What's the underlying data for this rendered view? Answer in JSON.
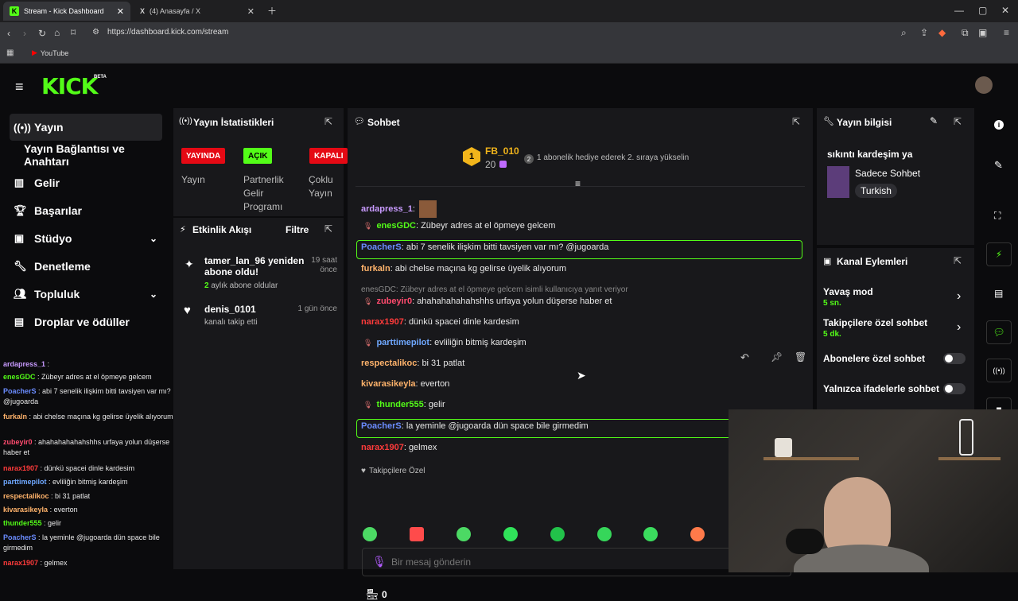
{
  "browser": {
    "tabs": [
      {
        "title": "Stream - Kick Dashboard",
        "active": true
      },
      {
        "title": "(4) Anasayfa / X",
        "active": false
      }
    ],
    "url": "https://dashboard.kick.com/stream",
    "bookmarks": [
      "YouTube"
    ]
  },
  "brand": {
    "logo": "KICK",
    "beta": "BETA",
    "accent": "#53fc18"
  },
  "sidebar": {
    "items": [
      {
        "label": "Yayın",
        "icon": "broadcast-icon",
        "active": true
      },
      {
        "label": "Yayın Bağlantısı ve Anahtarı",
        "icon": "",
        "active": false
      },
      {
        "label": "Gelir",
        "icon": "chart-icon",
        "active": false
      },
      {
        "label": "Başarılar",
        "icon": "trophy-icon",
        "active": false
      },
      {
        "label": "Stüdyo",
        "icon": "studio-icon",
        "active": false,
        "chevron": true
      },
      {
        "label": "Denetleme",
        "icon": "wrench-icon",
        "active": false
      },
      {
        "label": "Topluluk",
        "icon": "users-icon",
        "active": false,
        "chevron": true
      },
      {
        "label": "Droplar ve ödüller",
        "icon": "gift-icon",
        "active": false
      }
    ]
  },
  "side_chat": [
    {
      "user": "ardapress_1",
      "color": "#c99bff",
      "text": " : "
    },
    {
      "user": "enesGDC",
      "color": "#53fc18",
      "text": " : Zübeyr adres at el öpmeye gelcem"
    },
    {
      "user": "PoacherS",
      "color": "#6b8cff",
      "text": " : abi 7 senelik ilişkim bitti tavsiyen var mı? @jugoarda"
    },
    {
      "user": "furkaln",
      "color": "#ffb36b",
      "text": " : abi chelse maçına kg gelirse üyelik alıyorum"
    },
    {
      "user": "zubeyir0",
      "color": "#ff4b6e",
      "text": " : ahahahahahahshhs urfaya yolun düşerse haber et"
    },
    {
      "user": "narax1907",
      "color": "#ff3b3b",
      "text": " : dünkü spacei dinle kardesim"
    },
    {
      "user": "parttimepilot",
      "color": "#6fa8ff",
      "text": " : evliliğin bitmiş kardeşim"
    },
    {
      "user": "respectalikoc",
      "color": "#ffb36b",
      "text": " : bi 31 patlat"
    },
    {
      "user": "kivarasikeyla",
      "color": "#ffb36b",
      "text": " : everton"
    },
    {
      "user": "thunder555",
      "color": "#53fc18",
      "text": " : gelir"
    },
    {
      "user": "PoacherS",
      "color": "#6b8cff",
      "text": " : la yeminle @jugoarda dün space bile girmedim"
    },
    {
      "user": "narax1907",
      "color": "#ff3b3b",
      "text": " : gelmex"
    }
  ],
  "stats": {
    "title": "Yayın İstatistikleri",
    "badges": [
      {
        "text": "YAYINDA",
        "color": "#e50914",
        "text_color": "#ffffff",
        "label": "Yayın"
      },
      {
        "text": "AÇIK",
        "color": "#53fc18",
        "text_color": "#000000",
        "label": "Partnerlik Gelir Programı"
      },
      {
        "text": "KAPALI",
        "color": "#e50914",
        "text_color": "#ffffff",
        "label": "Çoklu Yayın"
      }
    ]
  },
  "activity": {
    "title": "Etkinlik Akışı",
    "filter": "Filtre",
    "items": [
      {
        "icon": "sparkle-icon",
        "title": "tamer_lan_96 yeniden abone oldu!",
        "highlight": "2",
        "detail": " aylık abone oldular",
        "time": "19 saat önce"
      },
      {
        "icon": "heart-icon",
        "title": "denis_0101",
        "highlight": "",
        "detail": "kanalı takip etti",
        "time": "1 gün önce"
      }
    ]
  },
  "chat": {
    "title": "Sohbet",
    "top_gifter": {
      "rank": "1",
      "name": "FB_010",
      "count": "20"
    },
    "gift_prompt": "1 abonelik hediye ederek 2. sıraya yükselin",
    "messages": [
      {
        "user": "ardapress_1",
        "color": "#c99bff",
        "text": ": "
      },
      {
        "user": "enesGDC",
        "color": "#53fc18",
        "text": ": Zübeyr adres at el öpmeye gelcem"
      },
      {
        "user": "PoacherS",
        "color": "#6b8cff",
        "text": ": abi 7 senelik ilişkim bitti tavsiyen var mı? @jugoarda",
        "highlight": true
      },
      {
        "user": "furkaln",
        "color": "#ffb36b",
        "text": ": abi chelse maçına kg gelirse üyelik alıyorum"
      },
      {
        "reply": "enesGDC: Zübeyr adres at el öpmeye gelcem isimli kullanıcıya yanıt veriyor",
        "user": "zubeyir0",
        "color": "#ff4b6e",
        "text": ": ahahahahahahshhs urfaya yolun düşerse haber et"
      },
      {
        "user": "narax1907",
        "color": "#ff3b3b",
        "text": ": dünkü spacei dinle kardesim"
      },
      {
        "user": "parttimepilot",
        "color": "#6fa8ff",
        "text": ": evliliğin bitmiş kardeşim"
      },
      {
        "user": "respectalikoc",
        "color": "#ffb36b",
        "text": ": bi 31 patlat"
      },
      {
        "user": "kivarasikeyla",
        "color": "#ffb36b",
        "text": ": everton"
      },
      {
        "user": "thunder555",
        "color": "#53fc18",
        "text": ": gelir"
      },
      {
        "user": "PoacherS",
        "color": "#6b8cff",
        "text": ": la yeminle @jugoarda dün space bile girmedim",
        "highlight": true
      },
      {
        "user": "narax1907",
        "color": "#ff3b3b",
        "text": ": gelmex"
      }
    ],
    "mode_label": "Takipçilere Özel",
    "input_placeholder": "Bir mesaj gönderin",
    "points": "0"
  },
  "stream_info": {
    "title": "Yayın bilgisi",
    "stream_title": "sıkıntı kardeşim ya",
    "category": "Sadece Sohbet",
    "language": "Turkish"
  },
  "channel_actions": {
    "title": "Kanal Eylemleri",
    "items": [
      {
        "label": "Yavaş mod",
        "sub": "5 sn.",
        "type": "chevron"
      },
      {
        "label": "Takipçilere özel sohbet",
        "sub": "5 dk.",
        "type": "chevron"
      },
      {
        "label": "Abonelere özel sohbet",
        "sub": "",
        "type": "toggle"
      },
      {
        "label": "Yalnızca ifadelerle sohbet",
        "sub": "",
        "type": "toggle"
      }
    ]
  }
}
